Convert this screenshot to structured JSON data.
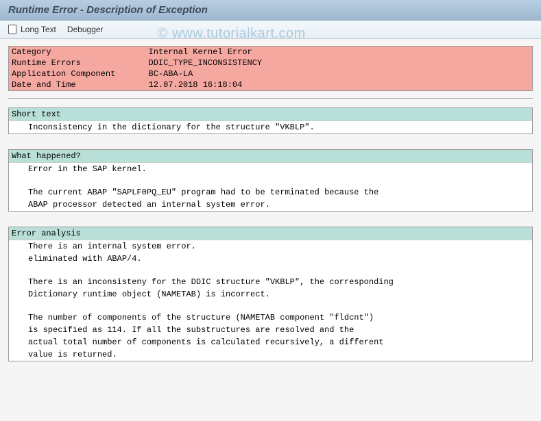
{
  "title": "Runtime Error - Description of Exception",
  "toolbar": {
    "long_text": "Long Text",
    "debugger": "Debugger"
  },
  "info": {
    "category_label": "Category",
    "category_value": "Internal Kernel Error",
    "runtime_errors_label": "Runtime Errors",
    "runtime_errors_value": "DDIC_TYPE_INCONSISTENCY",
    "app_component_label": "Application Component",
    "app_component_value": "BC-ABA-LA",
    "datetime_label": "Date and Time",
    "datetime_value": "12.07.2018 16:18:04"
  },
  "sections": {
    "short_text": {
      "header": "Short text",
      "line1": "Inconsistency in the dictionary for the structure \"VKBLP\"."
    },
    "what_happened": {
      "header": "What happened?",
      "line1": "Error in the SAP kernel.",
      "line2": "The current ABAP \"SAPLF0PQ_EU\" program had to be terminated because the",
      "line3": "ABAP processor detected an internal system error."
    },
    "error_analysis": {
      "header": "Error analysis",
      "line1": "There is an internal system error.",
      "line2": "eliminated with ABAP/4.",
      "line3": "There is an inconsisteny for the DDIC structure \"VKBLP\", the corresponding",
      "line4": "Dictionary runtime object (NAMETAB) is incorrect.",
      "line5": "The number of components of the structure (NAMETAB component \"fldcnt\")",
      "line6": "is specified as 114. If all the substructures are resolved and the",
      "line7": "actual total number of components is calculated recursively, a different",
      "line8": "value is returned."
    }
  },
  "watermark": "© www.tutorialkart.com"
}
